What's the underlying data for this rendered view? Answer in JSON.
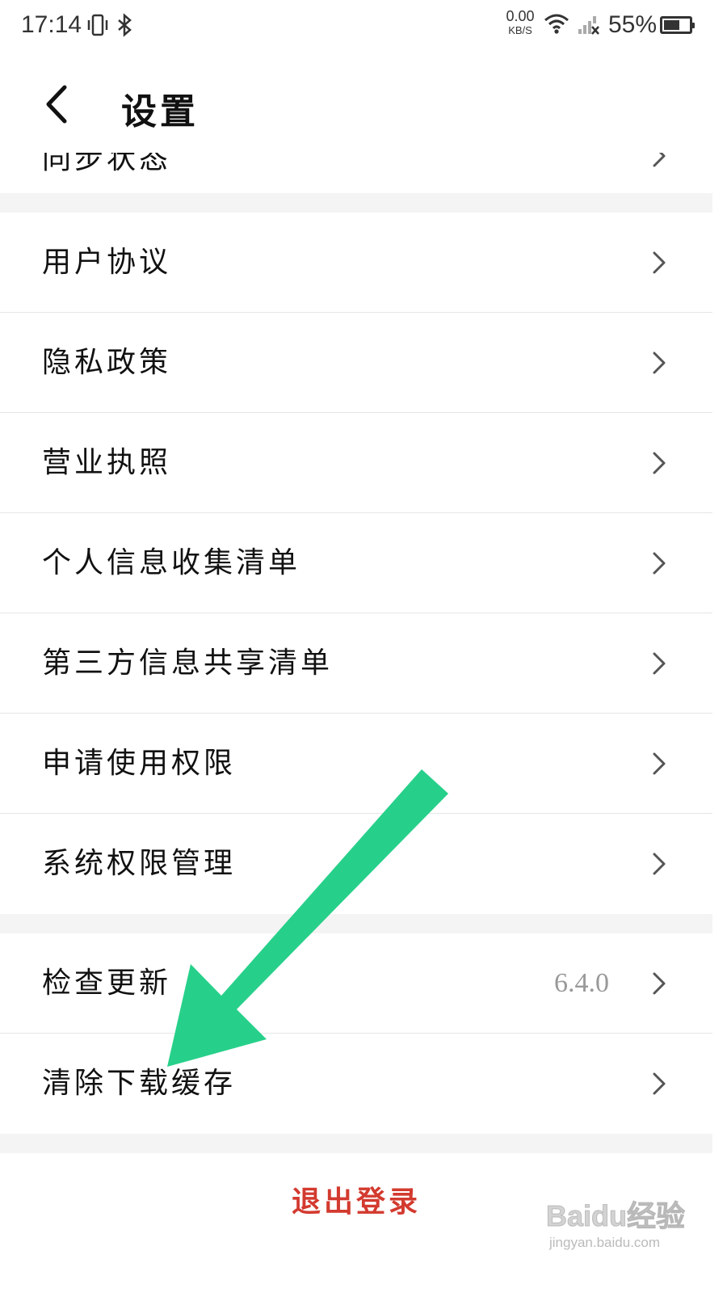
{
  "status_bar": {
    "time": "17:14",
    "net_speed_value": "0.00",
    "net_speed_unit": "KB/S",
    "battery_percent": "55%",
    "icons": [
      "vibrate-icon",
      "bluetooth-icon",
      "wifi-icon",
      "cellular-no-signal-icon",
      "battery-icon"
    ]
  },
  "header": {
    "title": "设置",
    "back_icon": "back-chevron-icon"
  },
  "partial_item": {
    "label": "同步状态"
  },
  "group1": [
    {
      "label": "用户协议"
    },
    {
      "label": "隐私政策"
    },
    {
      "label": "营业执照"
    },
    {
      "label": "个人信息收集清单"
    },
    {
      "label": "第三方信息共享清单"
    },
    {
      "label": "申请使用权限"
    },
    {
      "label": "系统权限管理"
    }
  ],
  "group2": [
    {
      "label": "检查更新",
      "value": "6.4.0"
    },
    {
      "label": "清除下载缓存"
    }
  ],
  "logout": {
    "label": "退出登录"
  },
  "annotation": {
    "type": "arrow",
    "color": "#27d08a"
  },
  "watermark": {
    "main": "Baidu经验",
    "sub": "jingyan.baidu.com"
  },
  "colors": {
    "logout": "#d33a2f",
    "divider": "#e6e6e6",
    "section_gap": "#f4f4f4",
    "value_text": "#999999"
  }
}
